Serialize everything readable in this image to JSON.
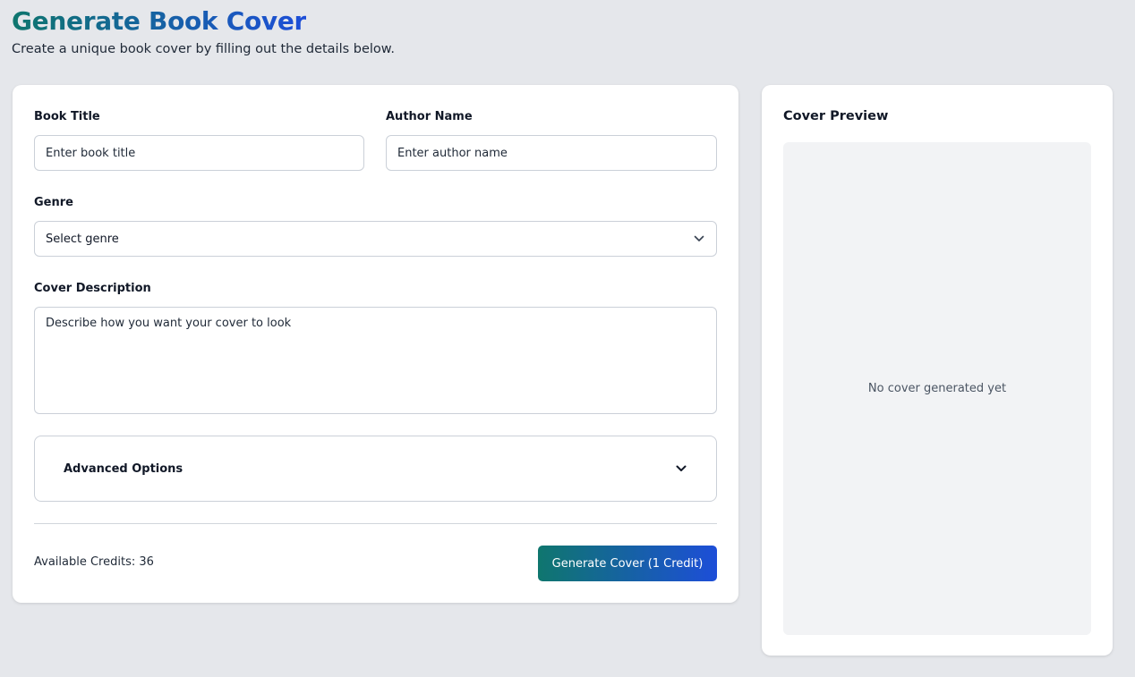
{
  "header": {
    "title": "Generate Book Cover",
    "subtitle": "Create a unique book cover by filling out the details below."
  },
  "form": {
    "book_title": {
      "label": "Book Title",
      "placeholder": "Enter book title",
      "value": ""
    },
    "author_name": {
      "label": "Author Name",
      "placeholder": "Enter author name",
      "value": ""
    },
    "genre": {
      "label": "Genre",
      "selected": "Select genre",
      "icon": "chevron-down-icon"
    },
    "cover_description": {
      "label": "Cover Description",
      "placeholder": "Describe how you want your cover to look",
      "value": ""
    },
    "advanced_options": {
      "label": "Advanced Options",
      "icon": "chevron-down-icon"
    },
    "credits_text": "Available Credits: 36",
    "generate_button": "Generate Cover (1 Credit)"
  },
  "preview": {
    "title": "Cover Preview",
    "empty_text": "No cover generated yet"
  },
  "colors": {
    "gradient_start": "#0f766e",
    "gradient_end": "#1d4ed8",
    "page_background": "#e5e7eb"
  }
}
